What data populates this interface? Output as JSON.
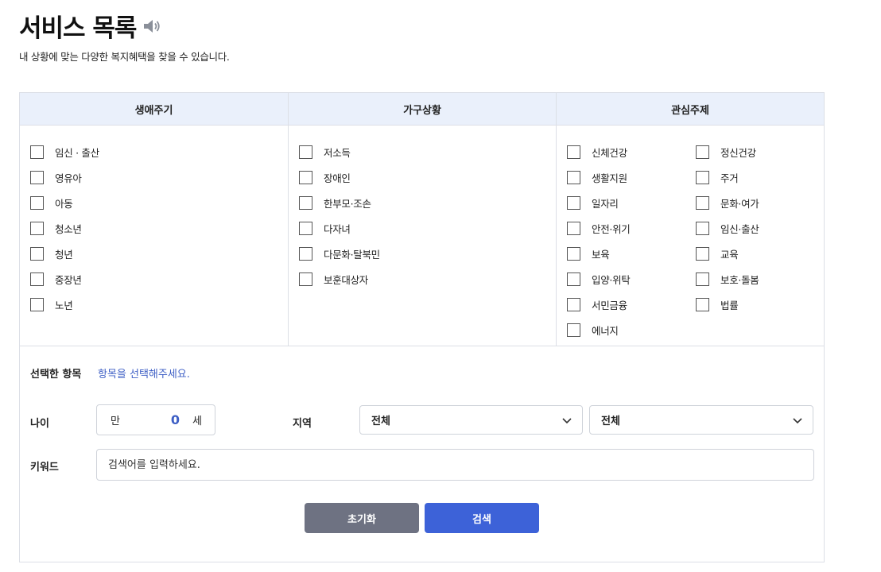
{
  "header": {
    "title": "서비스 목록",
    "subtitle": "내 상황에 맞는 다양한 복지혜택을 찾을 수 있습니다."
  },
  "categories": {
    "life_cycle": {
      "title": "생애주기",
      "items": [
        "임신 · 출산",
        "영유아",
        "아동",
        "청소년",
        "청년",
        "중장년",
        "노년"
      ]
    },
    "household": {
      "title": "가구상황",
      "items": [
        "저소득",
        "장애인",
        "한부모·조손",
        "다자녀",
        "다문화·탈북민",
        "보훈대상자"
      ]
    },
    "interest": {
      "title": "관심주제",
      "items_left": [
        "신체건강",
        "생활지원",
        "일자리",
        "안전·위기",
        "보육",
        "입양·위탁",
        "서민금융",
        "에너지"
      ],
      "items_right": [
        "정신건강",
        "주거",
        "문화·여가",
        "임신·출산",
        "교육",
        "보호·돌봄",
        "법률"
      ]
    }
  },
  "selection": {
    "label": "선택한 항목",
    "placeholder": "항목을 선택해주세요."
  },
  "age": {
    "label": "나이",
    "prefix": "만",
    "value": "0",
    "suffix": "세"
  },
  "region": {
    "label": "지역",
    "province": "전체",
    "district": "전체"
  },
  "keyword": {
    "label": "키워드",
    "placeholder": "검색어를 입력하세요."
  },
  "buttons": {
    "reset": "초기화",
    "search": "검색"
  },
  "colors": {
    "accent": "#3d62d8",
    "header_bg": "#eaf0fb",
    "reset_btn": "#6e7282",
    "link_text": "#3e5fc5"
  }
}
